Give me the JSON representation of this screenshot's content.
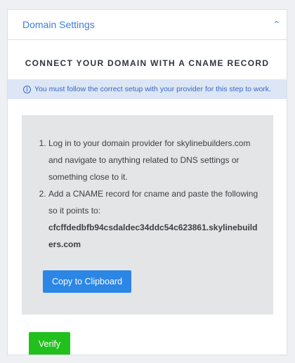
{
  "header": {
    "title": "Domain Settings",
    "toggle_icon": "chevron-up-icon"
  },
  "heading": "CONNECT YOUR DOMAIN WITH A CNAME RECORD",
  "info": {
    "icon": "info-icon",
    "icon_glyph": "i",
    "text": "You must follow the correct setup with your provider for this step to work."
  },
  "steps": [
    {
      "number": 1,
      "text": "Log in to your domain provider for skylinebuilders.com and navigate to anything related to DNS settings or something close to it."
    },
    {
      "number": 2,
      "text": "Add a CNAME record for cname and paste the following so it points to:",
      "value": "cfcffdedbfb94csdaldec34ddc54c623861.skylinebuilders.com"
    }
  ],
  "copy_button": "Copy to Clipboard",
  "verify_button": "Verify",
  "colors": {
    "accent": "#3b7ddd",
    "copy_button": "#2b86e6",
    "verify_button": "#22c01d",
    "info_background": "#dde6f5"
  }
}
